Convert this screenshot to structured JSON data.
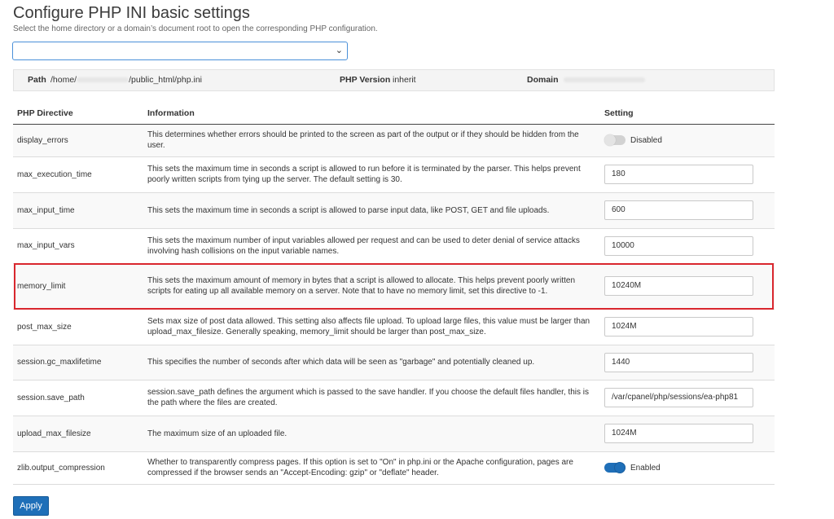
{
  "page": {
    "title": "Configure PHP INI basic settings",
    "subtitle": "Select the home directory or a domain’s document root to open the corresponding PHP configuration.",
    "select_value": ""
  },
  "info_bar": {
    "path_label": "Path",
    "path_prefix": "/home/",
    "path_suffix": "/public_html/php.ini",
    "version_label": "PHP Version",
    "version_value": "inherit",
    "domain_label": "Domain"
  },
  "table": {
    "headers": {
      "directive": "PHP Directive",
      "information": "Information",
      "setting": "Setting"
    },
    "rows": [
      {
        "directive": "display_errors",
        "info": "This determines whether errors should be printed to the screen as part of the output or if they should be hidden from the user.",
        "type": "toggle",
        "state": "off",
        "label": "Disabled"
      },
      {
        "directive": "max_execution_time",
        "info": "This sets the maximum time in seconds a script is allowed to run before it is terminated by the parser. This helps prevent poorly written scripts from tying up the server. The default setting is 30.",
        "type": "input",
        "value": "180"
      },
      {
        "directive": "max_input_time",
        "info": "This sets the maximum time in seconds a script is allowed to parse input data, like POST, GET and file uploads.",
        "type": "input",
        "value": "600"
      },
      {
        "directive": "max_input_vars",
        "info": "This sets the maximum number of input variables allowed per request and can be used to deter denial of service attacks involving hash collisions on the input variable names.",
        "type": "input",
        "value": "10000"
      },
      {
        "directive": "memory_limit",
        "info": "This sets the maximum amount of memory in bytes that a script is allowed to allocate. This helps prevent poorly written scripts for eating up all available memory on a server. Note that to have no memory limit, set this directive to -1.",
        "type": "input",
        "value": "10240M"
      },
      {
        "directive": "post_max_size",
        "info": "Sets max size of post data allowed. This setting also affects file upload. To upload large files, this value must be larger than upload_max_filesize. Generally speaking, memory_limit should be larger than post_max_size.",
        "type": "input",
        "value": "1024M"
      },
      {
        "directive": "session.gc_maxlifetime",
        "info": "This specifies the number of seconds after which data will be seen as \"garbage\" and potentially cleaned up.",
        "type": "input",
        "value": "1440"
      },
      {
        "directive": "session.save_path",
        "info": "session.save_path defines the argument which is passed to the save handler. If you choose the default files handler, this is the path where the files are created.",
        "type": "input",
        "value": "/var/cpanel/php/sessions/ea-php81"
      },
      {
        "directive": "upload_max_filesize",
        "info": "The maximum size of an uploaded file.",
        "type": "input",
        "value": "1024M"
      },
      {
        "directive": "zlib.output_compression",
        "info": "Whether to transparently compress pages. If this option is set to \"On\" in php.ini or the Apache configuration, pages are compressed if the browser sends an \"Accept-Encoding: gzip\" or \"deflate\" header.",
        "type": "toggle",
        "state": "on",
        "label": "Enabled"
      }
    ]
  },
  "actions": {
    "apply_label": "Apply"
  },
  "colors": {
    "accent": "#1f6fb8",
    "highlight": "#d9272e",
    "select_border": "#4a90d9"
  }
}
